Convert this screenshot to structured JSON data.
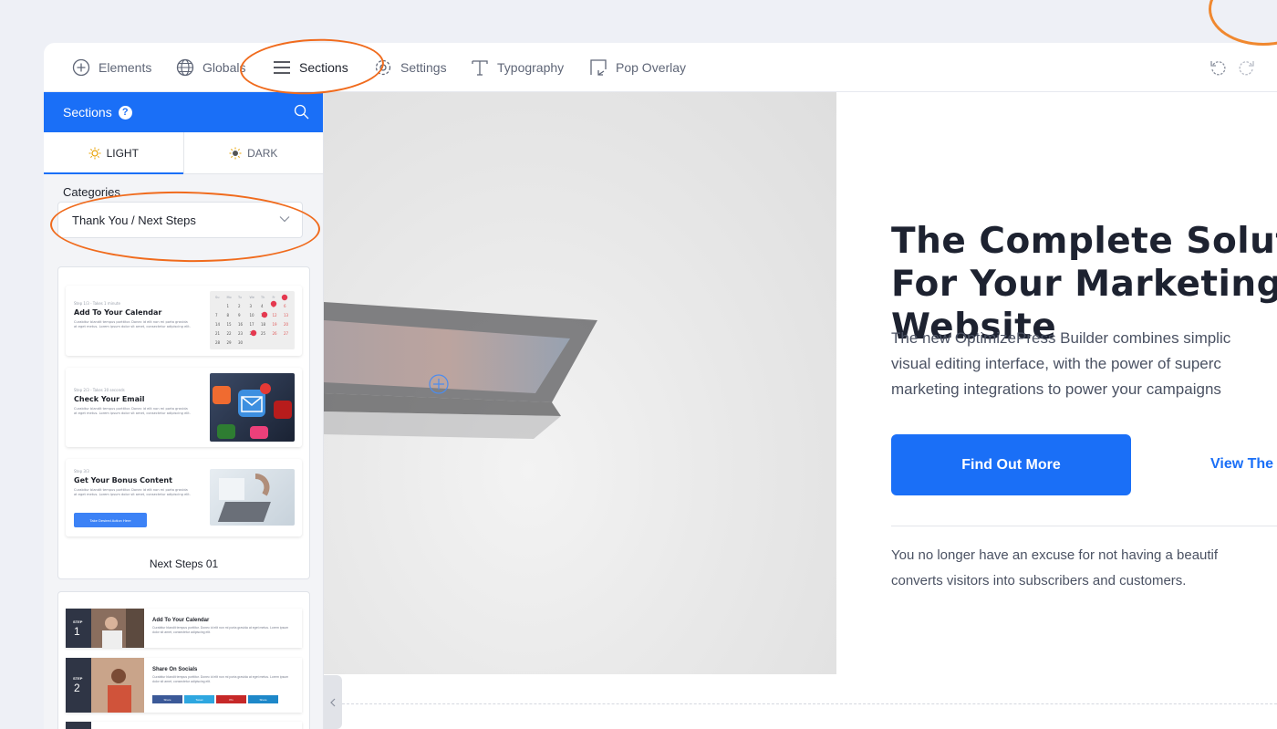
{
  "toolbar": {
    "elements_label": "Elements",
    "globals_label": "Globals",
    "sections_label": "Sections",
    "settings_label": "Settings",
    "typography_label": "Typography",
    "pop_overlay_label": "Pop Overlay",
    "active_tab": "Sections"
  },
  "sidebar": {
    "title": "Sections",
    "help_glyph": "?",
    "tabs": [
      {
        "label": "LIGHT",
        "icon": "bulb-icon",
        "active": true
      },
      {
        "label": "DARK",
        "icon": "bulb-dark-icon",
        "active": false
      }
    ],
    "categories_label": "Categories",
    "category_selected": "Thank You / Next Steps",
    "templates": [
      {
        "caption": "Next Steps 01",
        "blocks": [
          {
            "step": "Step 1/3 - Takes 1 minute",
            "title": "Add To Your Calendar",
            "text": "Curabitur blandit tempus porttitor. Donec id elit non mi porta gravida at eget metus. Lorem ipsum dolor sit amet, consectetur adipiscing elit."
          },
          {
            "step": "Step 2/3 - Takes 30 seconds",
            "title": "Check Your Email",
            "text": "Curabitur blandit tempus porttitor. Donec id elit non mi porta gravida at eget metus. Lorem ipsum dolor sit amet, consectetur adipiscing elit."
          },
          {
            "step": "Step 3/3",
            "title": "Get Your Bonus Content",
            "text": "Curabitur blandit tempus porttitor. Donec id elit non mi porta gravida at eget metus. Lorem ipsum dolor sit amet, consectetur adipiscing elit.",
            "button": "Take Desired Action Here"
          }
        ]
      },
      {
        "rows": [
          {
            "step_label": "STEP",
            "number": "1",
            "title": "Add To Your Calendar",
            "text": "Curabitur blandit tempus porttitor. Donec id elit non mi porta gravida at eget metus. Lorem ipsum dolor sit amet, consectetur adipiscing elit."
          },
          {
            "step_label": "STEP",
            "number": "2",
            "title": "Share On Socials",
            "text": "Curabitur blandit tempus porttitor. Donec id elit non mi porta gravida at eget metus. Lorem ipsum dolor sit amet, consectetur adipiscing elit.",
            "share_buttons": [
              "Share",
              "Tweet",
              "Pin",
              "Share"
            ]
          }
        ]
      }
    ]
  },
  "canvas": {
    "headline_1": "The Complete Soluti",
    "headline_2": "For Your Marketing",
    "headline_3": "Website",
    "sub_1": "The new OptimizePress Builder combines simplic",
    "sub_2": "visual editing interface, with the power of superc",
    "sub_3": "marketing integrations to power your campaigns",
    "cta_primary": "Find Out More",
    "cta_secondary": "View The",
    "foot_1": "You no longer have an excuse for not having a beautif",
    "foot_2": "converts visitors into subscribers and customers."
  },
  "calendar": {
    "days": [
      "Su",
      "Mo",
      "Tu",
      "We",
      "Th",
      "Fr",
      "Sa"
    ],
    "dates": [
      "",
      "1",
      "2",
      "3",
      "4",
      "5",
      "6",
      "7",
      "8",
      "9",
      "10",
      "11",
      "12",
      "13",
      "14",
      "15",
      "16",
      "17",
      "18",
      "19",
      "20",
      "21",
      "22",
      "23",
      "24",
      "25",
      "26",
      "27",
      "28",
      "29",
      "30"
    ]
  },
  "colors": {
    "accent": "#1a6ff7",
    "annotation": "#f06b1d"
  }
}
